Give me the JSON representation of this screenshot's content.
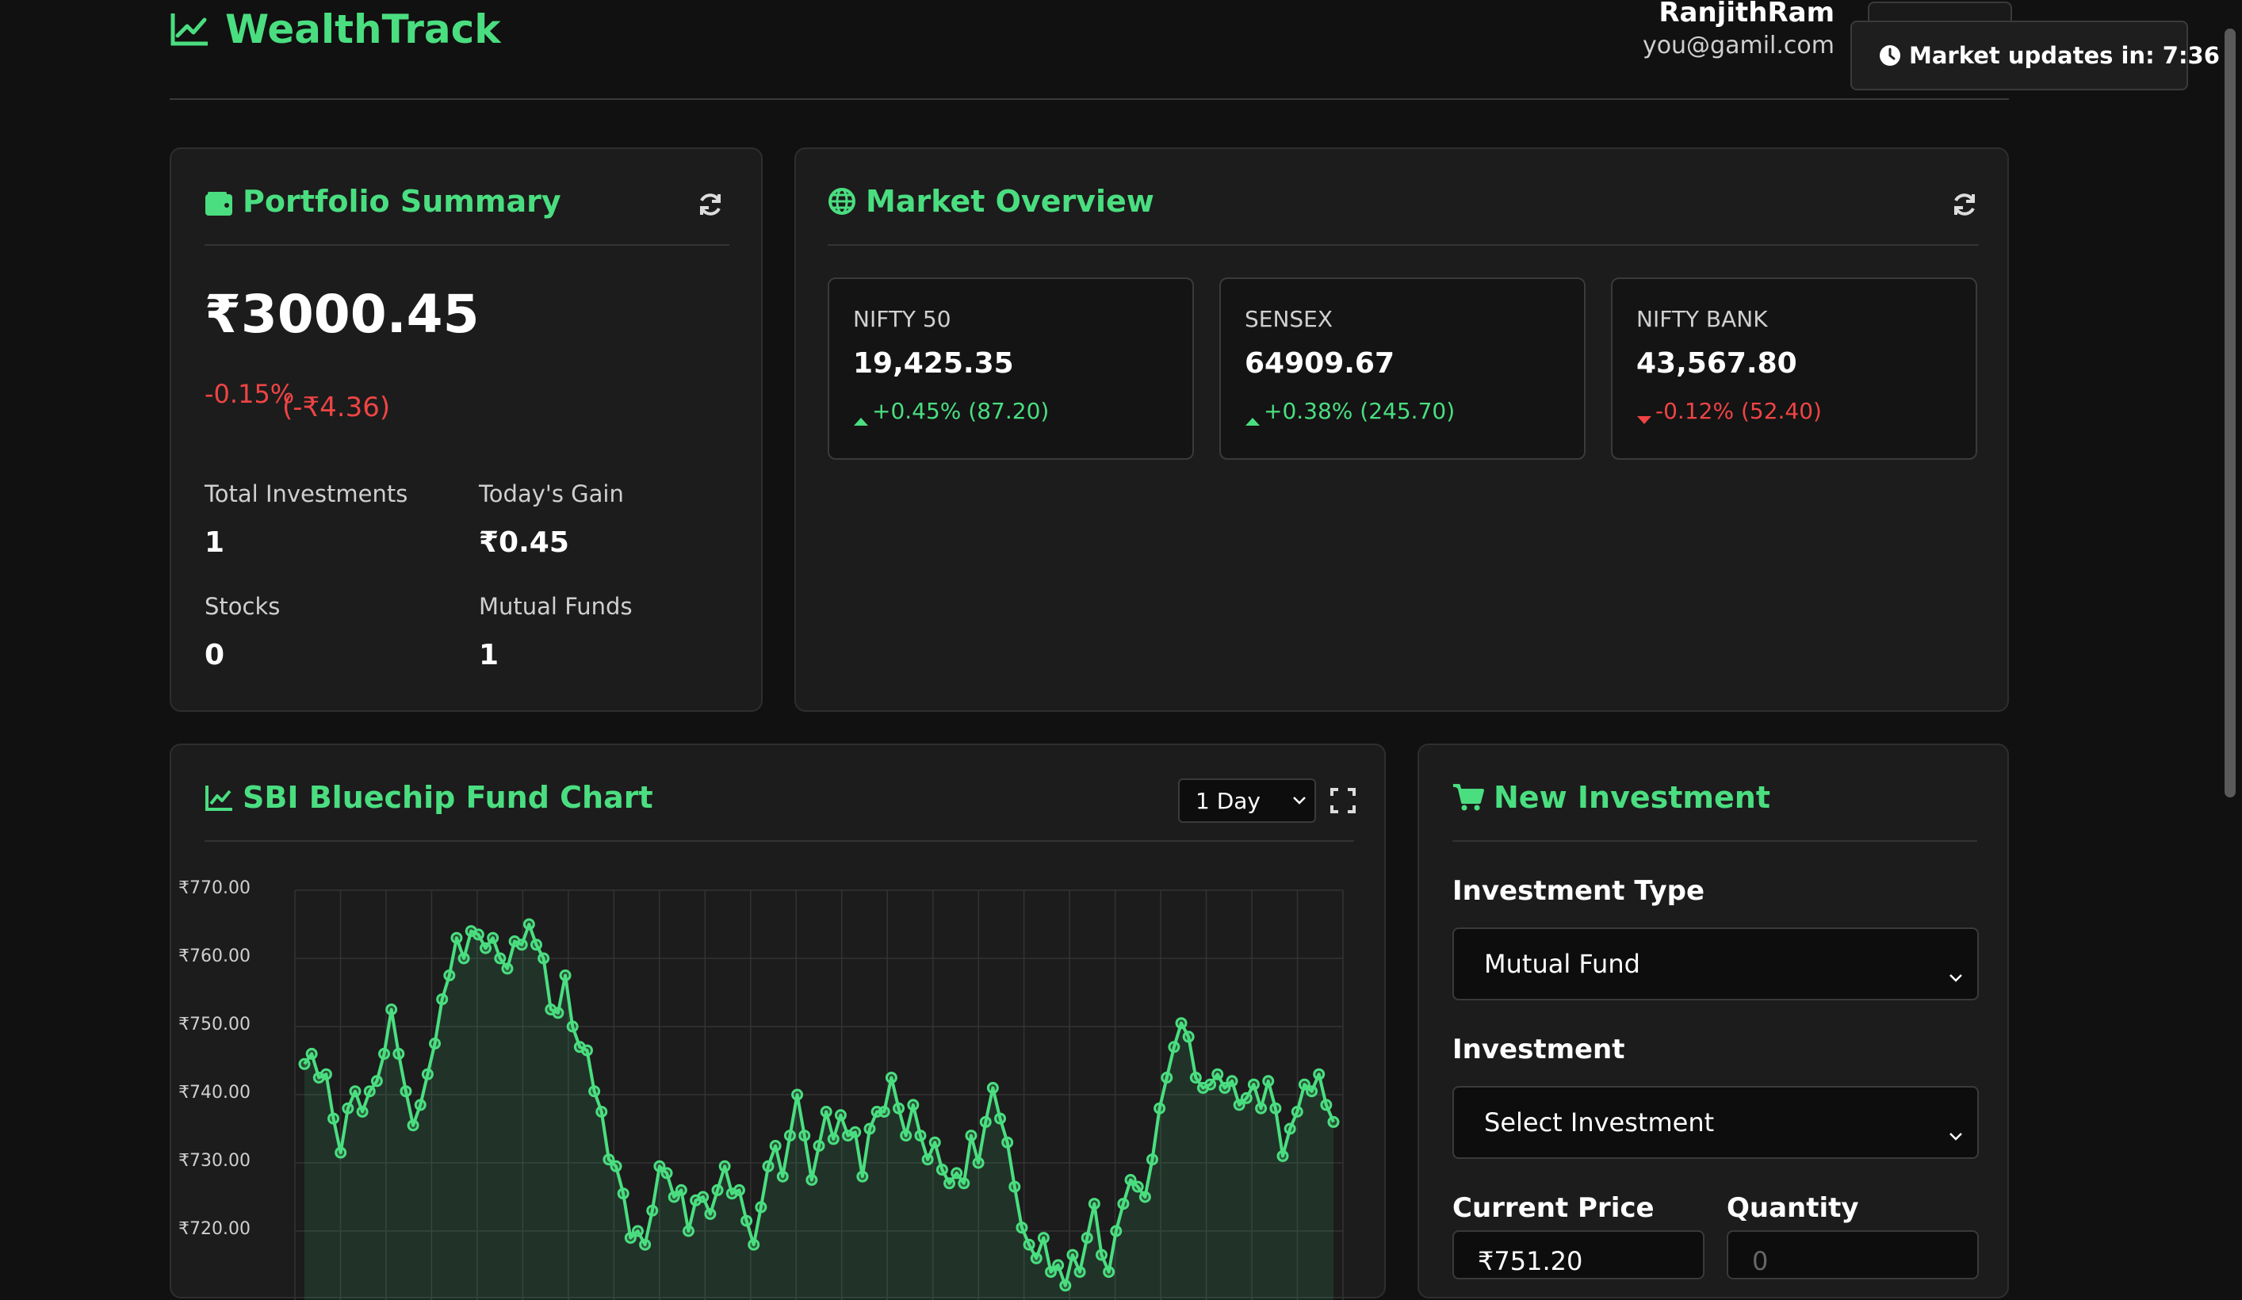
{
  "header": {
    "app_title": "WealthTrack",
    "user_name": "RanjithRam",
    "user_email": "you@gamil.com",
    "toast_text": "Market updates in: 7:36"
  },
  "portfolio": {
    "title": "Portfolio Summary",
    "total_value": "₹3000.45",
    "change_pct": "-0.15%",
    "change_abs": "(-₹4.36)",
    "stats": [
      {
        "label": "Total Investments",
        "value": "1"
      },
      {
        "label": "Today's Gain",
        "value": "₹0.45"
      },
      {
        "label": "Stocks",
        "value": "0"
      },
      {
        "label": "Mutual Funds",
        "value": "1"
      }
    ]
  },
  "market": {
    "title": "Market Overview",
    "indices": [
      {
        "name": "NIFTY 50",
        "value": "19,425.35",
        "change": "+0.45% (87.20)",
        "direction": "up"
      },
      {
        "name": "SENSEX",
        "value": "64909.67",
        "change": "+0.38% (245.70)",
        "direction": "up"
      },
      {
        "name": "NIFTY BANK",
        "value": "43,567.80",
        "change": "-0.12% (52.40)",
        "direction": "down"
      }
    ]
  },
  "chart_card": {
    "title": "SBI Bluechip Fund Chart",
    "range_selected": "1 Day"
  },
  "new_investment": {
    "title": "New Investment",
    "type_label": "Investment Type",
    "type_value": "Mutual Fund",
    "investment_label": "Investment",
    "investment_value": "Select Investment",
    "price_label": "Current Price",
    "price_value": "₹751.20",
    "quantity_label": "Quantity",
    "quantity_placeholder": "0"
  },
  "colors": {
    "accent": "#4ade80",
    "negative": "#ef4444",
    "background": "#111111",
    "card": "#1c1c1c"
  },
  "chart_data": {
    "type": "area",
    "title": "SBI Bluechip Fund Chart",
    "xlabel": "",
    "ylabel": "",
    "ylim": [
      715,
      770
    ],
    "yticks": [
      "₹770.00",
      "₹760.00",
      "₹750.00",
      "₹740.00",
      "₹730.00",
      "₹720.00"
    ],
    "grid": true,
    "series": [
      {
        "values": [
          744.5,
          746,
          742.5,
          743,
          736.5,
          731.5,
          738,
          740.5,
          737.5,
          740.5,
          742,
          746,
          752.5,
          746,
          740.5,
          735.5,
          738.5,
          743,
          747.5,
          754,
          757.5,
          763,
          760,
          764,
          763.5,
          761.5,
          763,
          760,
          758.5,
          762.5,
          762,
          765,
          762,
          760,
          752.5,
          752,
          757.5,
          750,
          747,
          746.5,
          740.5,
          737.5,
          730.5,
          729.5,
          725.5,
          719,
          720,
          718,
          723,
          729.5,
          728.5,
          725,
          726,
          720,
          724.5,
          725,
          722.5,
          726,
          729.5,
          725.5,
          726,
          721.5,
          718,
          723.5,
          729.5,
          732.5,
          728,
          734,
          740,
          734,
          727.5,
          732.5,
          737.5,
          733.5,
          737,
          734,
          734.5,
          728,
          735,
          737.5,
          737.5,
          742.5,
          738,
          734,
          738.5,
          734,
          730.5,
          733,
          729,
          727,
          728.5,
          727,
          734,
          730,
          736,
          741,
          736.5,
          733,
          726.5,
          720.5,
          718,
          716,
          719,
          714,
          715,
          712,
          716.5,
          714,
          719,
          724,
          716.5,
          714,
          720,
          724,
          727.5,
          726.5,
          725,
          730.5,
          738,
          742.5,
          747,
          750.5,
          748.5,
          742.5,
          741,
          741.5,
          743,
          741,
          742,
          738.5,
          739.5,
          741.5,
          738,
          742,
          738,
          731,
          735,
          737.5,
          741.5,
          740.5,
          743,
          738.5,
          736
        ]
      }
    ]
  }
}
